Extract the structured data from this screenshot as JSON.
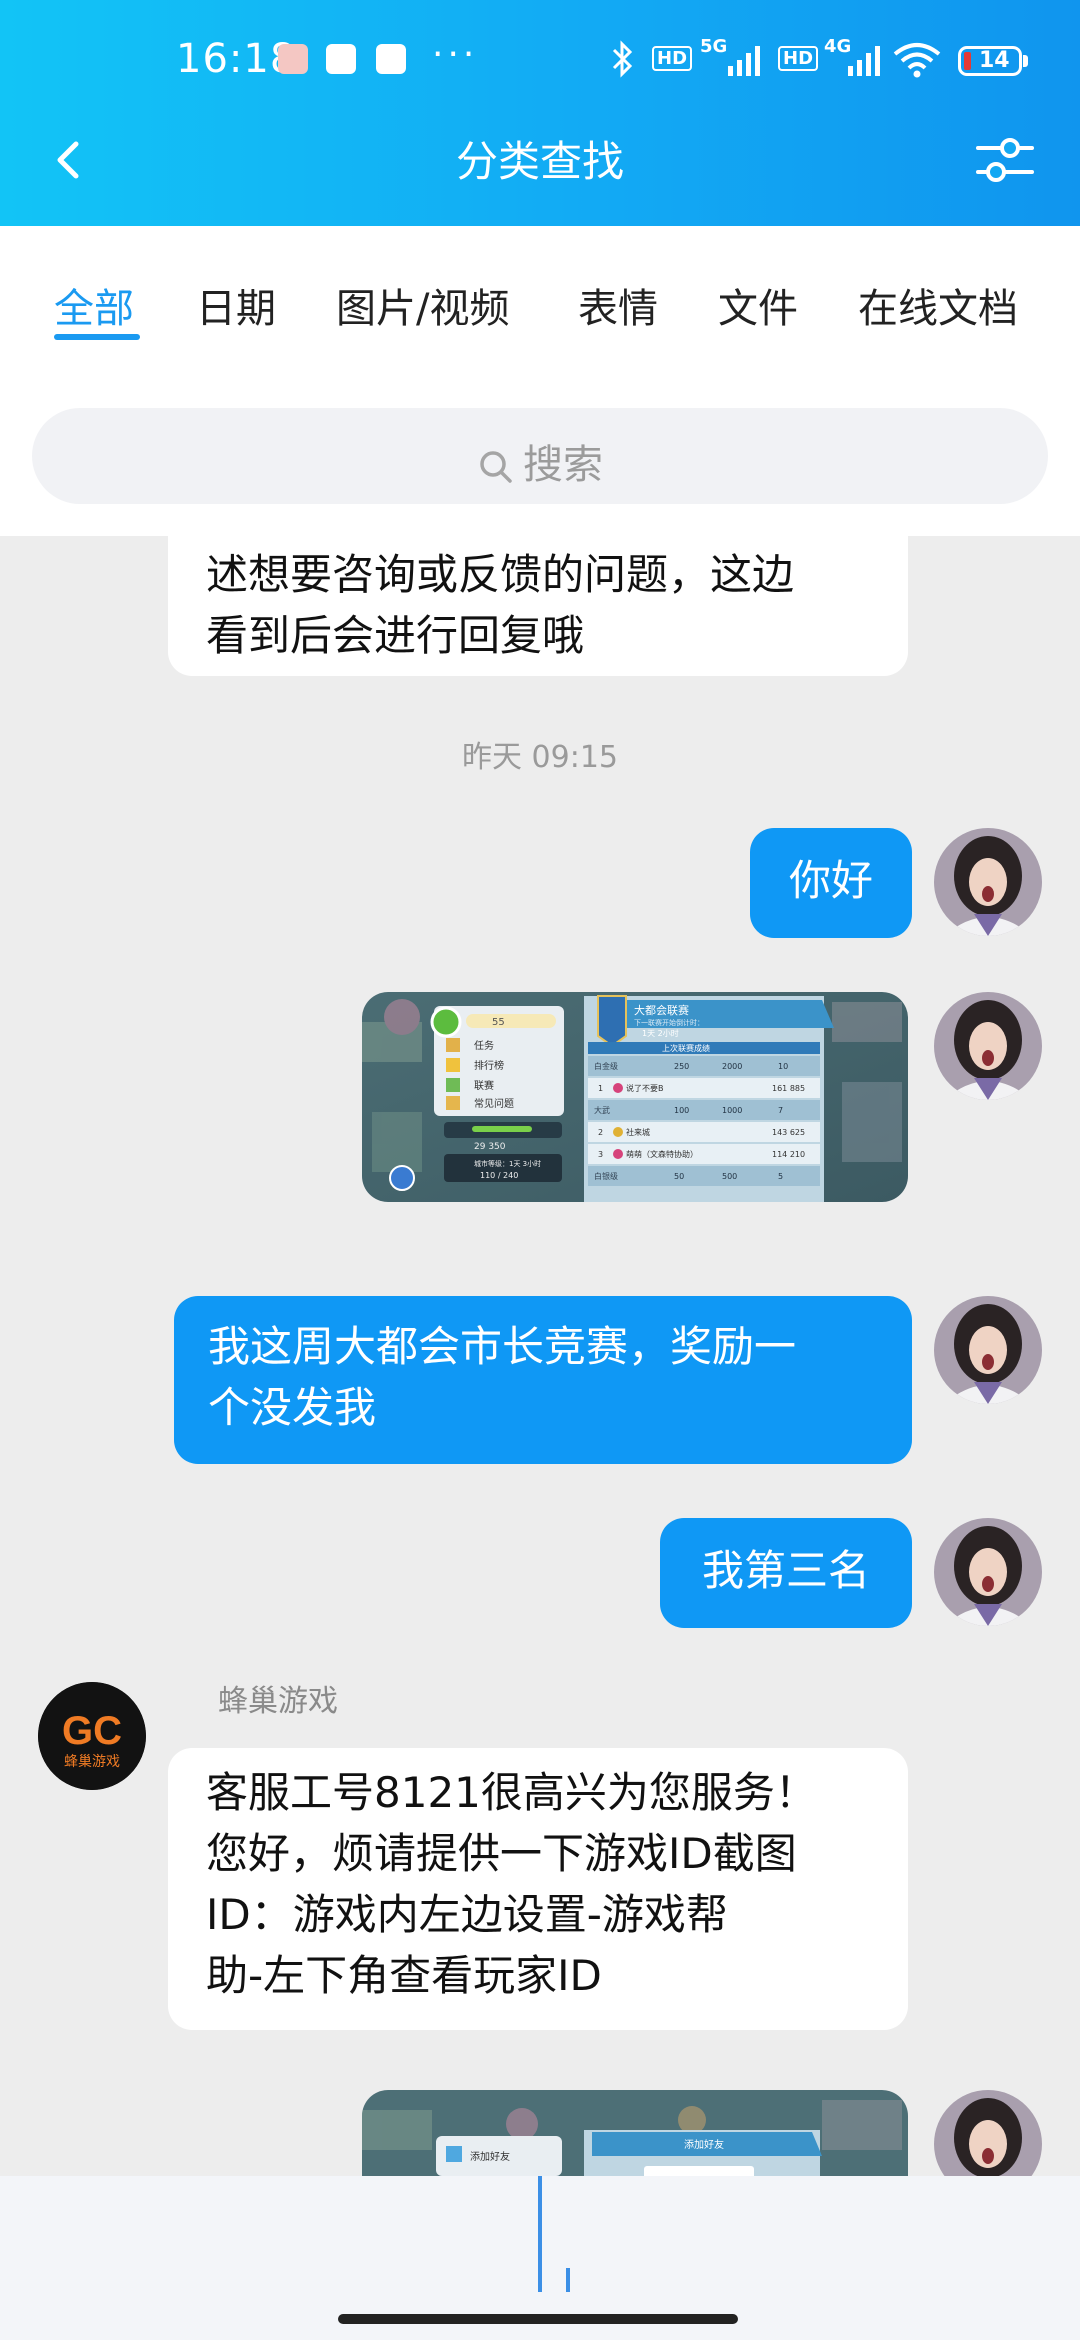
{
  "status_bar": {
    "time": "16:18",
    "dots": "···",
    "hd1": "HD",
    "net1": "5G",
    "hd2": "HD",
    "net2": "4G",
    "battery": "14"
  },
  "nav": {
    "title": "分类查找"
  },
  "tabs": [
    {
      "label": "全部",
      "active": true
    },
    {
      "label": "日期"
    },
    {
      "label": "图片/视频"
    },
    {
      "label": "表情"
    },
    {
      "label": "文件"
    },
    {
      "label": "在线文档"
    }
  ],
  "search": {
    "placeholder": "搜索"
  },
  "messages": {
    "m0_line1": "述想要咨询或反馈的问题，这边",
    "m0_line2": "看到后会进行回复哦",
    "timestamp": "昨天 09:15",
    "m1": "你好",
    "m3_line1": "我这周大都会市长竞赛，奖励一",
    "m3_line2": "个没发我",
    "m4": "我第三名",
    "sender_name": "蜂巢游戏",
    "m5_line1": "客服工号8121很高兴为您服务！",
    "m5_line2": "您好，烦请提供一下游戏ID截图",
    "m5_line3": "ID：游戏内左边设置-游戏帮",
    "m5_line4": "助-左下角查看玩家ID"
  },
  "game_screenshot_1": {
    "menu_value": "55",
    "menu_items": [
      "任务",
      "排行榜",
      "联赛",
      "常见问题"
    ],
    "stat1": "29 350",
    "stat2": "城市等级：1天 3小时",
    "stat3": "110 / 240",
    "panel_title": "大都会联赛",
    "panel_sub": "下一联赛开始倒计时：",
    "panel_time": "1天 2小时",
    "panel_section": "上次联赛成绩",
    "tier1": "白金级",
    "tier1_vals": [
      "250",
      "2000",
      "10"
    ],
    "rank1_name": "说了不要B",
    "rank1_score": "161 885",
    "tier2": "大武",
    "tier2_vals": [
      "100",
      "1000",
      "7"
    ],
    "rank2_name": "社来城",
    "rank2_score": "143 625",
    "rank3_name": "萌萌（文森特协助）",
    "rank3_score": "114 210",
    "tier3": "白银级",
    "tier3_vals": [
      "50",
      "500",
      "5"
    ]
  },
  "game_screenshot_2": {
    "menu_item": "添加好友",
    "panel_title": "添加好友"
  },
  "logo": {
    "text": "GC",
    "sub": "蜂巢游戏"
  }
}
